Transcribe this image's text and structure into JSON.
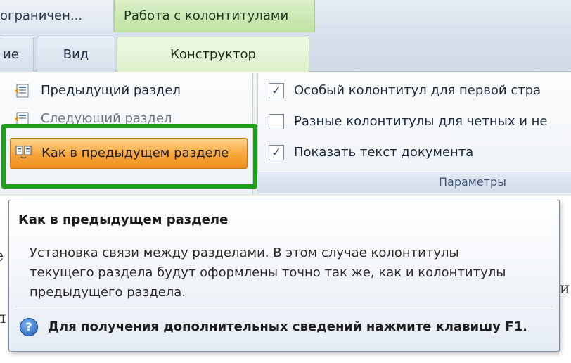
{
  "tabs_top": {
    "truncated_left": "ограничен...",
    "context_header": "Работа с колонтитулами"
  },
  "tabs": {
    "home_fragment": "ие",
    "view": "Вид",
    "design": "Конструктор"
  },
  "navigation": {
    "prev_section": "Предыдущий раздел",
    "next_section": "Следующий раздел",
    "link_to_previous": "Как в предыдущем разделе"
  },
  "options": {
    "items": [
      {
        "label": "Особый колонтитул для первой стра",
        "checked": true
      },
      {
        "label": "Разные колонтитулы для четных и не",
        "checked": false
      },
      {
        "label": "Показать текст документа",
        "checked": true
      }
    ],
    "group_label": "Параметры"
  },
  "tooltip": {
    "title": "Как в предыдущем разделе",
    "description": "Установка связи между разделами. В этом случае колонтитулы текущего раздела будут оформлены точно так же, как и колонтитулы предыдущего раздела.",
    "help_text": "Для получения дополнительных сведений нажмите клавишу F1."
  },
  "icons": {
    "prev": "previous-section-icon",
    "next": "next-section-icon",
    "link": "link-to-previous-icon",
    "help": "help-icon",
    "checkmark": "checkmark-icon"
  },
  "colors": {
    "highlight_frame": "#1e9e1a",
    "button_highlight": "#f6a53a",
    "context_tab": "#bfe3a2"
  }
}
